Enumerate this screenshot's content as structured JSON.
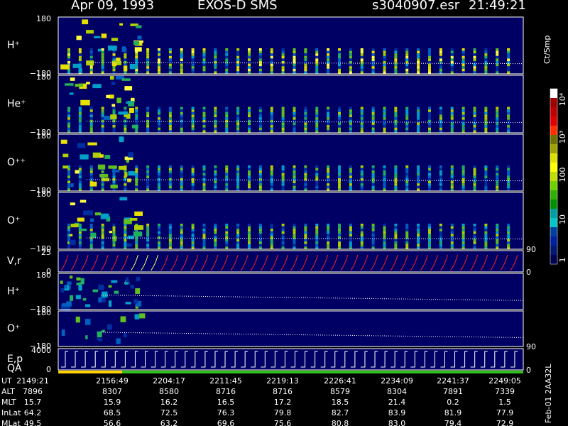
{
  "header": {
    "date": "Apr 09, 1993",
    "instrument": "EXOS-D SMS",
    "file": "s3040907.esr",
    "time": "21:49:21"
  },
  "colorbar": {
    "unit": "Ct/Smp",
    "ticks": [
      "10⁴",
      "10³",
      "100",
      "10",
      "1"
    ],
    "stops": [
      "#ffffff",
      "#a00000",
      "#c00000",
      "#e00000",
      "#ff3000",
      "#707000",
      "#a0a000",
      "#e0e000",
      "#ffff00",
      "#c0e000",
      "#70d000",
      "#30b000",
      "#009000",
      "#00a0a0",
      "#00c8c8",
      "#0040a0",
      "#0020a0",
      "#001870",
      "#000050"
    ]
  },
  "panels": [
    {
      "label": "H⁺",
      "ytop": "180",
      "ybottom": "−180"
    },
    {
      "label": "He⁺",
      "ytop": "180",
      "ybottom": "−180"
    },
    {
      "label": "O⁺⁺",
      "ytop": "180",
      "ybottom": "−180"
    },
    {
      "label": "O⁺",
      "ytop": "180",
      "ybottom": "−180"
    },
    {
      "label": "V,r",
      "ytop": "25",
      "ybottom": "0",
      "right_top": "90",
      "right_bottom": "0"
    },
    {
      "label": "H⁺",
      "ytop": "180",
      "ybottom": "−180"
    },
    {
      "label": "O⁺",
      "ytop": "180",
      "ybottom": "−180",
      "right_bottom": "90"
    },
    {
      "label": "E,p",
      "label2": "QA",
      "ytop": "4000",
      "ybottom": "0",
      "right_bottom": "0"
    }
  ],
  "footer": {
    "rows": [
      {
        "name": "UT",
        "values": [
          "2149:21",
          "2156:49",
          "2204:17",
          "2211:45",
          "2219:13",
          "2226:41",
          "2234:09",
          "2241:37",
          "2249:05"
        ]
      },
      {
        "name": "ALT",
        "values": [
          "7896",
          "8307",
          "8580",
          "8716",
          "8716",
          "8579",
          "8304",
          "7891",
          "7339"
        ]
      },
      {
        "name": "MLT",
        "values": [
          "15.7",
          "15.9",
          "16.2",
          "16.5",
          "17.2",
          "18.5",
          "21.4",
          "0.2",
          "1.5"
        ]
      },
      {
        "name": "InLat",
        "values": [
          "64.2",
          "68.5",
          "72.5",
          "76.3",
          "79.8",
          "82.7",
          "83.9",
          "81.9",
          "77.9"
        ]
      },
      {
        "name": "MLat",
        "values": [
          "49.5",
          "56.6",
          "63.2",
          "69.6",
          "75.6",
          "80.8",
          "83.0",
          "79.4",
          "72.9"
        ]
      }
    ],
    "stamp": "Feb-01 2AA32L"
  },
  "colors": {
    "background": "#000000",
    "panel": "#000064",
    "frame": "#ffffff",
    "vr_trace": "#ff2020",
    "qa_bar": "#ffd000"
  },
  "chart_data": {
    "type": "heatmap",
    "title": "Apr 09, 1993 EXOS-D SMS",
    "xlabel": "UT",
    "x_ticks": [
      "2149:21",
      "2156:49",
      "2204:17",
      "2211:45",
      "2219:13",
      "2226:41",
      "2234:09",
      "2241:37",
      "2249:05"
    ],
    "y_range_pitch_angle": [
      -180,
      180
    ],
    "y_range_vr": [
      0,
      25
    ],
    "y_range_energy": [
      0,
      4000
    ],
    "color_scale": "log",
    "color_range": [
      1,
      10000
    ],
    "series": [
      {
        "name": "H⁺",
        "panel": 0,
        "spin_sweeps": 40,
        "peak_intensity": 1000
      },
      {
        "name": "He⁺",
        "panel": 1,
        "spin_sweeps": 40,
        "peak_intensity": 200
      },
      {
        "name": "O⁺⁺",
        "panel": 2,
        "spin_sweeps": 40,
        "peak_intensity": 100
      },
      {
        "name": "O⁺",
        "panel": 3,
        "spin_sweeps": 40,
        "peak_intensity": 150
      },
      {
        "name": "V,r",
        "panel": 4,
        "spin_sweeps": 46
      },
      {
        "name": "H⁺",
        "panel": 5,
        "spin_sweeps": 0,
        "peak_intensity": 50
      },
      {
        "name": "O⁺",
        "panel": 6,
        "spin_sweeps": 0,
        "peak_intensity": 10
      },
      {
        "name": "E,p",
        "panel": 7,
        "spin_sweeps": 46
      }
    ]
  }
}
